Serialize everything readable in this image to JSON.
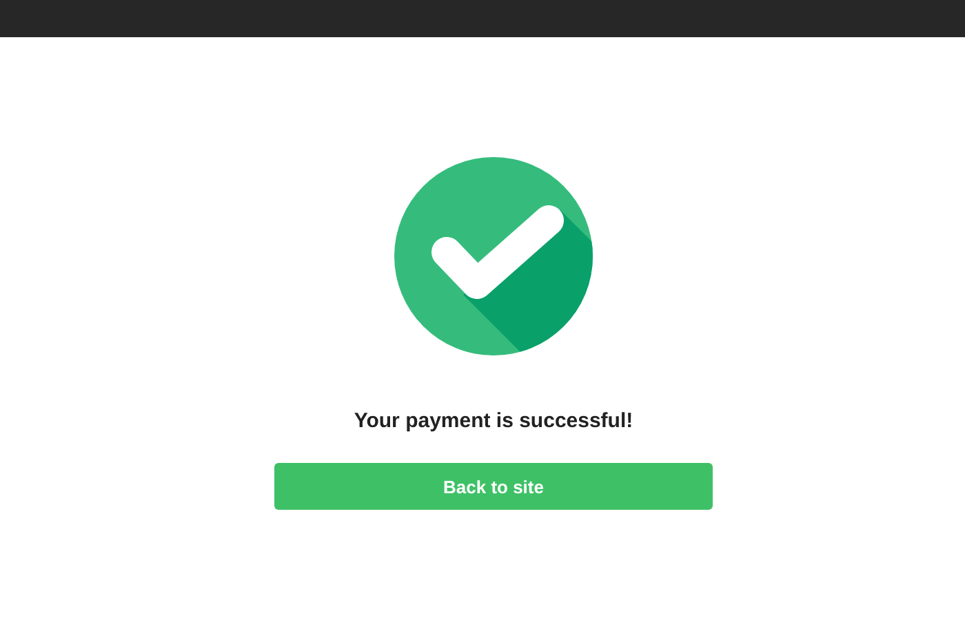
{
  "message": "Your payment is successful!",
  "button": {
    "label": "Back to site"
  }
}
